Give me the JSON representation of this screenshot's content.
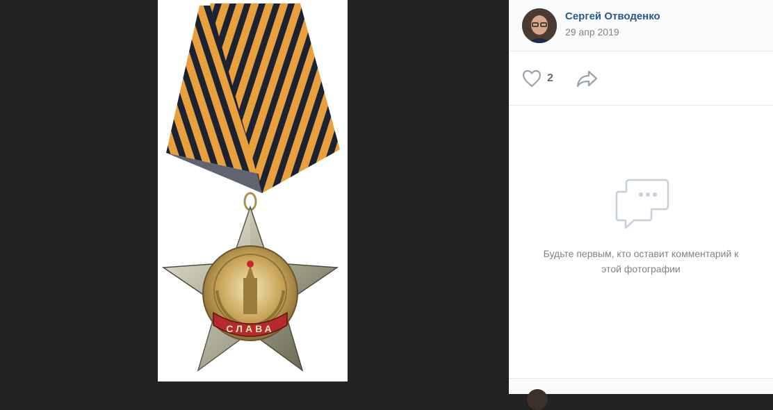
{
  "post": {
    "author_name": "Сергей Отводенко",
    "date": "29 апр 2019"
  },
  "actions": {
    "like_count": "2",
    "like_icon": "heart-icon",
    "share_icon": "share-arrow-icon"
  },
  "comments": {
    "empty_icon": "comment-bubble-icon",
    "empty_text": "Будьте первым, кто оставит комментарий к этой фотографии"
  },
  "photo": {
    "medal_inscription": "СЛАВА"
  },
  "colors": {
    "link": "#2a5885",
    "muted": "#828282",
    "viewer_bg": "#222222",
    "ribbon_orange": "#e8a03c",
    "ribbon_black": "#1d2233"
  }
}
